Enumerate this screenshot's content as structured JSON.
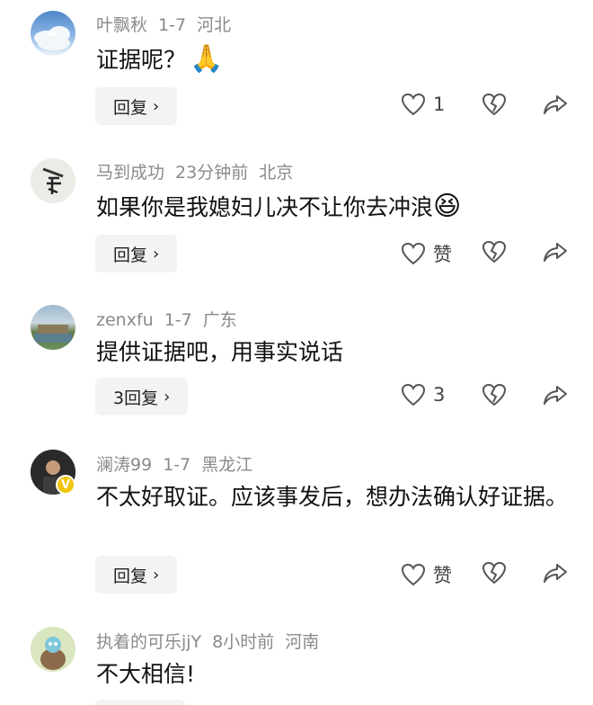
{
  "comments": [
    {
      "username": "叶飘秋",
      "date": "1-7",
      "location": "河北",
      "text": "证据呢？",
      "emoji": "🙏",
      "reply_label": "回复",
      "like_count": "1"
    },
    {
      "username": "马到成功",
      "date": "23分钟前",
      "location": "北京",
      "text": "如果你是我媳妇儿决不让你去冲浪",
      "emoji": "😆",
      "reply_label": "回复",
      "like_count": "赞"
    },
    {
      "username": "zenxfu",
      "date": "1-7",
      "location": "广东",
      "text": "提供证据吧，用事实说话",
      "emoji": "",
      "reply_label": "3回复",
      "like_count": "3"
    },
    {
      "username": "澜涛99",
      "date": "1-7",
      "location": "黑龙江",
      "text": "不太好取证。应该事发后，想办法确认好证据。",
      "emoji": "",
      "reply_label": "回复",
      "like_count": "赞",
      "badge": "V"
    },
    {
      "username": "执着的可乐jjY",
      "date": "8小时前",
      "location": "河南",
      "text": "不大相信!",
      "emoji": ""
    }
  ],
  "icons": {
    "like": "heart-outline-icon",
    "dislike": "broken-heart-icon",
    "share": "share-arrow-icon",
    "chevron": "chevron-right-icon"
  }
}
